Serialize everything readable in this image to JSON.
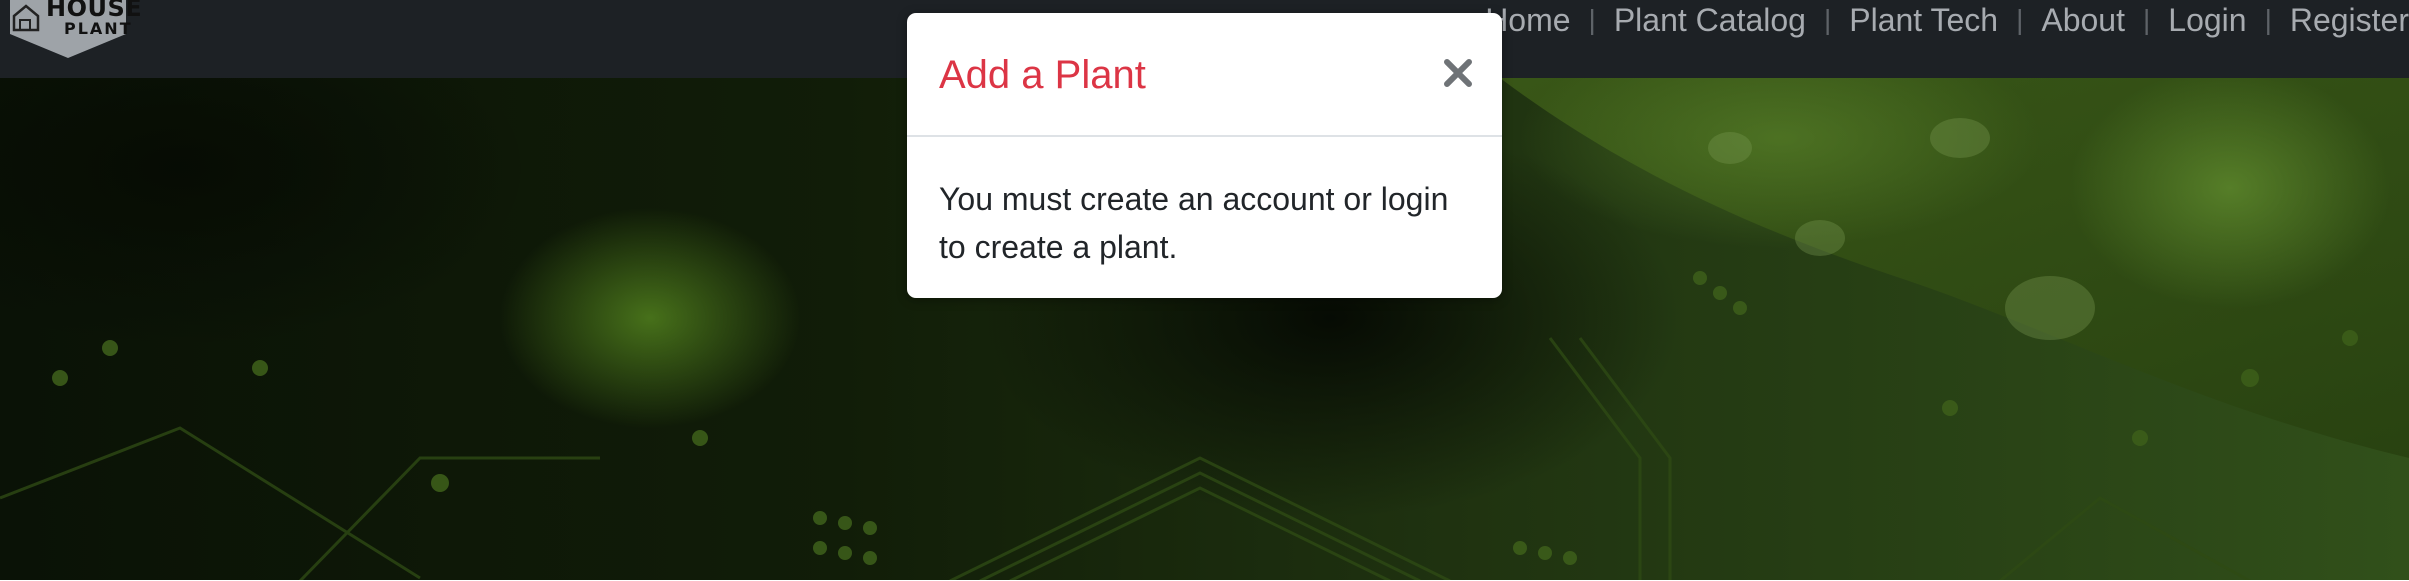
{
  "brand": {
    "line1": "HOUSE",
    "line2": "PLANT"
  },
  "nav": {
    "items": [
      {
        "label": "Home"
      },
      {
        "label": "Plant Catalog"
      },
      {
        "label": "Plant Tech"
      },
      {
        "label": "About"
      },
      {
        "label": "Login"
      },
      {
        "label": "Register"
      }
    ],
    "separator": "|"
  },
  "modal": {
    "title": "Add a Plant",
    "close_icon": "close-icon",
    "body_text": "You must create an account or login to create a plant."
  },
  "colors": {
    "navbar_bg": "#1d2125",
    "nav_text": "#a7abb0",
    "modal_title": "#dc3545",
    "hero_green": "#3f5e17"
  }
}
